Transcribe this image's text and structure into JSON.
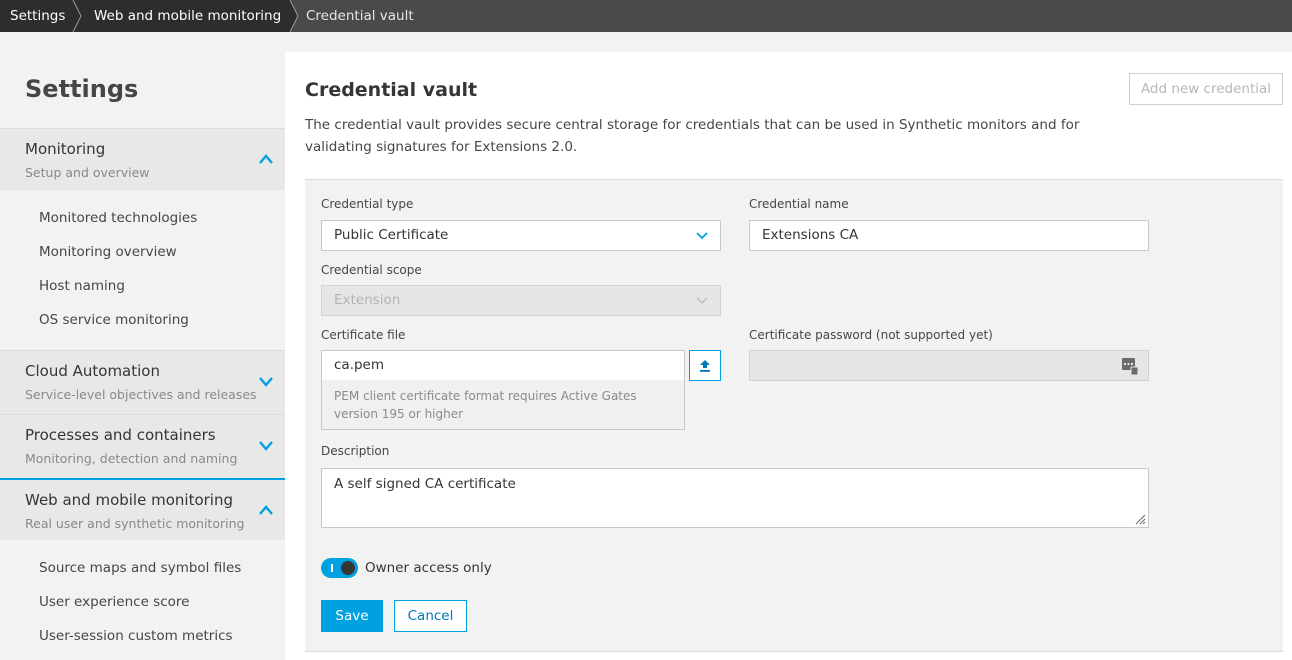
{
  "breadcrumb": {
    "items": [
      "Settings",
      "Web and mobile monitoring",
      "Credential vault"
    ]
  },
  "sidebar": {
    "title": "Settings",
    "sections": [
      {
        "title": "Monitoring",
        "subtitle": "Setup and overview",
        "expanded": true,
        "items": [
          "Monitored technologies",
          "Monitoring overview",
          "Host naming",
          "OS service monitoring"
        ]
      },
      {
        "title": "Cloud Automation",
        "subtitle": "Service-level objectives and releases",
        "expanded": false
      },
      {
        "title": "Processes and containers",
        "subtitle": "Monitoring, detection and naming",
        "expanded": false
      },
      {
        "title": "Web and mobile monitoring",
        "subtitle": "Real user and synthetic monitoring",
        "expanded": true,
        "items": [
          "Source maps and symbol files",
          "User experience score",
          "User-session custom metrics"
        ]
      }
    ]
  },
  "main": {
    "title": "Credential vault",
    "add_button": "Add new credential",
    "description": "The credential vault provides secure central storage for credentials that can be used in Synthetic monitors and for validating signatures for Extensions 2.0."
  },
  "form": {
    "credential_type": {
      "label": "Credential type",
      "value": "Public Certificate"
    },
    "credential_name": {
      "label": "Credential name",
      "value": "Extensions CA"
    },
    "credential_scope": {
      "label": "Credential scope",
      "value": "Extension"
    },
    "certificate_file": {
      "label": "Certificate file",
      "value": "ca.pem",
      "hint": "PEM client certificate format requires Active Gates version 195 or higher"
    },
    "certificate_password": {
      "label": "Certificate password (not supported yet)",
      "value": ""
    },
    "description": {
      "label": "Description",
      "value": "A self signed CA certificate"
    },
    "owner_access": {
      "label": "Owner access only",
      "enabled": true
    },
    "save_label": "Save",
    "cancel_label": "Cancel"
  },
  "colors": {
    "accent": "#00a1e0",
    "breadcrumb_bg": "#4a4a4a",
    "breadcrumb_active_bg": "#2d2d2d"
  },
  "icons": [
    "chevron-right-icon",
    "chevron-up-icon",
    "chevron-down-icon",
    "upload-icon",
    "password-generator-icon",
    "resize-grip-icon"
  ]
}
